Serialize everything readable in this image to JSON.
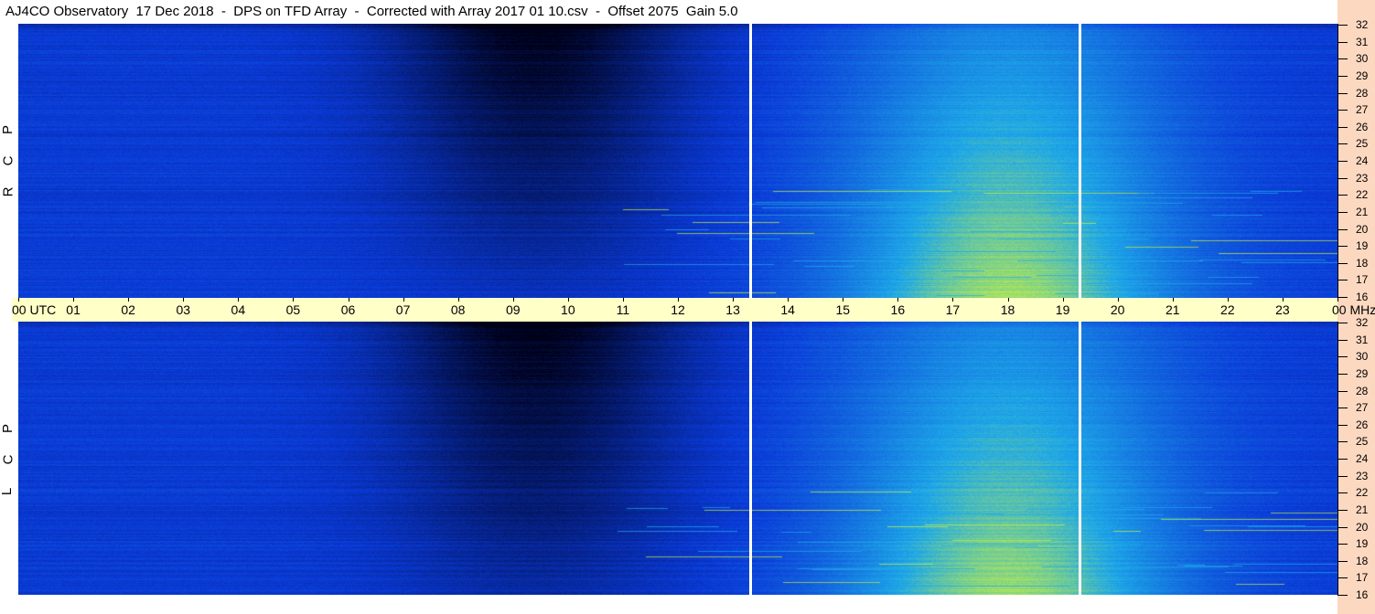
{
  "title": "AJ4CO Observatory  17 Dec 2018  -  DPS on TFD Array  -  Corrected with Array 2017 01 10.csv  -  Offset 2075  Gain 5.0",
  "chart_data": [
    {
      "type": "heatmap",
      "panel": "RCP",
      "side_label": [
        "R",
        "C",
        "P"
      ],
      "x_tick_labels": [
        "00 UTC",
        "01",
        "02",
        "03",
        "04",
        "05",
        "06",
        "07",
        "08",
        "09",
        "10",
        "11",
        "12",
        "13",
        "14",
        "15",
        "16",
        "17",
        "18",
        "19",
        "20",
        "21",
        "22",
        "23",
        "00 MHz"
      ],
      "x_range_hours": [
        0,
        24
      ],
      "y_unit": "MHz",
      "y_range": [
        16,
        32
      ],
      "y_tick_labels": [
        "32",
        "31",
        "30",
        "29",
        "28",
        "27",
        "26",
        "25",
        "24",
        "23",
        "22",
        "21",
        "20",
        "19",
        "18",
        "17",
        "16"
      ],
      "markers_hours": [
        13.32,
        19.3
      ]
    },
    {
      "type": "heatmap",
      "panel": "LCP",
      "side_label": [
        "L",
        "C",
        "P"
      ],
      "x_range_hours": [
        0,
        24
      ],
      "y_unit": "MHz",
      "y_range": [
        16,
        32
      ],
      "y_tick_labels": [
        "32",
        "31",
        "30",
        "29",
        "28",
        "27",
        "26",
        "25",
        "24",
        "23",
        "22",
        "21",
        "20",
        "19",
        "18",
        "17",
        "16"
      ],
      "markers_hours": [
        13.32,
        19.3
      ]
    }
  ],
  "colors": {
    "background_strip": "#fcd8c0",
    "axis_band": "#ffffc8",
    "quiet": "#0a3ad8",
    "dark": "#000016",
    "active": "#1ea8e8",
    "hot": "#c8f040"
  }
}
